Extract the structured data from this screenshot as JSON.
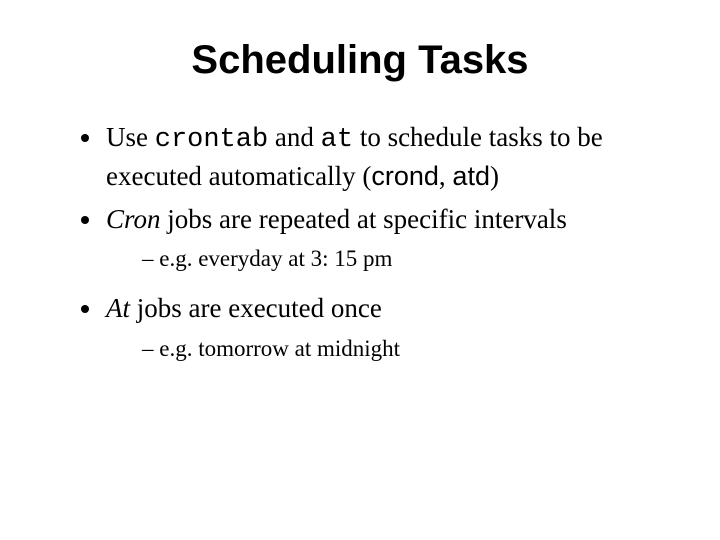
{
  "title": "Scheduling Tasks",
  "bullets": [
    {
      "pre": "Use ",
      "code1": "crontab",
      "mid1": " and ",
      "code2": "at",
      "mid2": " to schedule tasks to be executed automatically (",
      "sans1": "crond",
      "mid3": ", ",
      "sans2": "atd",
      "post": ")"
    },
    {
      "ital": "Cron",
      "rest": " jobs are repeated at specific intervals",
      "sub": "e.g. everyday at 3: 15 pm"
    },
    {
      "ital": "At",
      "rest": " jobs are executed once",
      "sub": "e.g. tomorrow at midnight"
    }
  ]
}
